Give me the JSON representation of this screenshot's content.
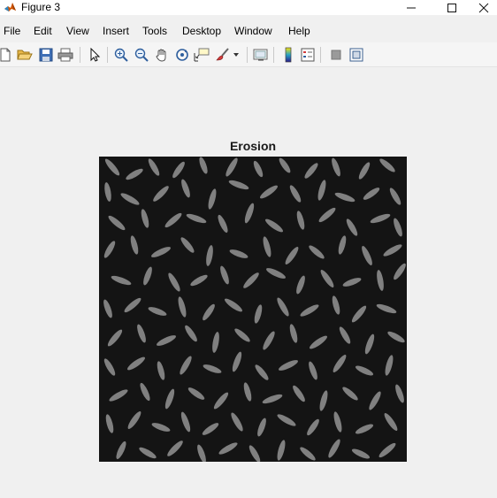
{
  "window": {
    "title": "Figure 3"
  },
  "menubar": {
    "items": [
      {
        "label": "File"
      },
      {
        "label": "Edit"
      },
      {
        "label": "View"
      },
      {
        "label": "Insert"
      },
      {
        "label": "Tools"
      },
      {
        "label": "Desktop"
      },
      {
        "label": "Window"
      },
      {
        "label": "Help"
      }
    ]
  },
  "toolbar": {
    "buttons": [
      {
        "icon": "new-figure-icon"
      },
      {
        "icon": "open-file-icon"
      },
      {
        "icon": "save-icon"
      },
      {
        "icon": "print-icon"
      },
      {
        "icon": "pointer-icon"
      },
      {
        "icon": "zoom-in-icon"
      },
      {
        "icon": "zoom-out-icon"
      },
      {
        "icon": "pan-hand-icon"
      },
      {
        "icon": "rotate-3d-icon"
      },
      {
        "icon": "data-cursor-icon"
      },
      {
        "icon": "brush-icon"
      },
      {
        "icon": "link-plot-icon"
      },
      {
        "icon": "colorbar-icon"
      },
      {
        "icon": "legend-icon"
      },
      {
        "icon": "hide-plot-tools-icon"
      },
      {
        "icon": "show-plot-tools-icon"
      }
    ]
  },
  "axes": {
    "title": "Erosion",
    "image_description_colors": {
      "background": "#141414",
      "grains": "#8a8a8a"
    }
  }
}
